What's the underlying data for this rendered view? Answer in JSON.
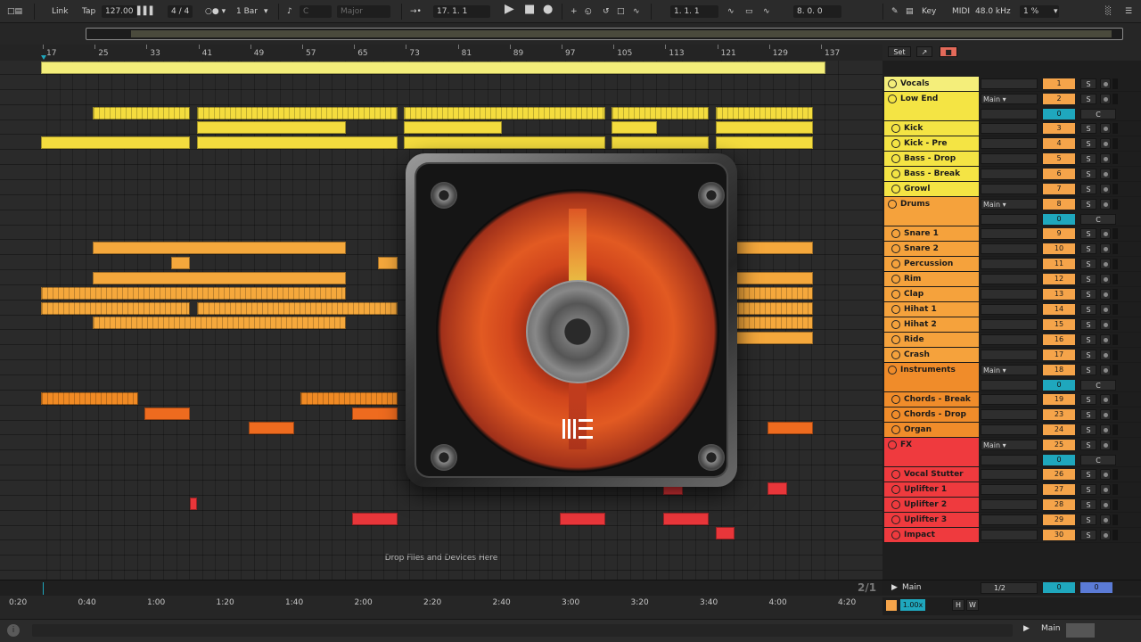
{
  "transport": {
    "link": "Link",
    "tap": "Tap",
    "tempo": "127.00",
    "signature": "4 / 4",
    "quantize": "1 Bar",
    "key_root": "C",
    "scale": "Major",
    "position": "17.  1.  1",
    "loop_start": "1.  1.  1",
    "loop_length": "8.  0.  0",
    "key_label": "Key",
    "midi_label": "MIDI",
    "sample_rate": "48.0 kHz",
    "cpu": "1 %"
  },
  "ruler": [
    "17",
    "25",
    "33",
    "41",
    "49",
    "57",
    "65",
    "73",
    "81",
    "89",
    "97",
    "105",
    "113",
    "121",
    "129",
    "137"
  ],
  "drop_hint": "Drop Files and Devices Here",
  "set_buttons": {
    "set": "Set"
  },
  "colors": {
    "yellow": "#f4dc3e",
    "yellow_light": "#f6f07a",
    "orange": "#f5a83c",
    "orange_dark": "#f08a24",
    "deep_orange": "#ee6b1f",
    "red": "#e8363a"
  },
  "tracks": [
    {
      "name": "Vocals",
      "color": "#f4ee7a",
      "group": false,
      "child": false,
      "number": "1",
      "height": 17
    },
    {
      "name": "Low End",
      "color": "#f4e444",
      "group": true,
      "child": false,
      "number": "2",
      "routing": "Main",
      "pan": "0",
      "c": "C",
      "height": 33
    },
    {
      "name": "Kick",
      "color": "#f4e444",
      "group": false,
      "child": true,
      "number": "3",
      "height": 17
    },
    {
      "name": "Kick - Pre",
      "color": "#f4e444",
      "group": false,
      "child": true,
      "number": "4",
      "height": 17
    },
    {
      "name": "Bass - Drop",
      "color": "#f4e444",
      "group": false,
      "child": true,
      "number": "5",
      "height": 17
    },
    {
      "name": "Bass - Break",
      "color": "#f4e444",
      "group": false,
      "child": true,
      "number": "6",
      "height": 17
    },
    {
      "name": "Growl",
      "color": "#f4e444",
      "group": false,
      "child": true,
      "number": "7",
      "height": 17
    },
    {
      "name": "Drums",
      "color": "#f5a23c",
      "group": true,
      "child": false,
      "number": "8",
      "routing": "Main",
      "pan": "0",
      "c": "C",
      "height": 33
    },
    {
      "name": "Snare 1",
      "color": "#f5a23c",
      "group": false,
      "child": true,
      "number": "9",
      "height": 17
    },
    {
      "name": "Snare 2",
      "color": "#f5a23c",
      "group": false,
      "child": true,
      "number": "10",
      "height": 17
    },
    {
      "name": "Percussion",
      "color": "#f5a23c",
      "group": false,
      "child": true,
      "number": "11",
      "height": 17
    },
    {
      "name": "Rim",
      "color": "#f5a23c",
      "group": false,
      "child": true,
      "number": "12",
      "height": 17
    },
    {
      "name": "Clap",
      "color": "#f5a23c",
      "group": false,
      "child": true,
      "number": "13",
      "height": 17
    },
    {
      "name": "Hihat 1",
      "color": "#f5a23c",
      "group": false,
      "child": true,
      "number": "14",
      "height": 17
    },
    {
      "name": "Hihat 2",
      "color": "#f5a23c",
      "group": false,
      "child": true,
      "number": "15",
      "height": 17
    },
    {
      "name": "Ride",
      "color": "#f5a23c",
      "group": false,
      "child": true,
      "number": "16",
      "height": 17
    },
    {
      "name": "Crash",
      "color": "#f5a23c",
      "group": false,
      "child": true,
      "number": "17",
      "height": 17
    },
    {
      "name": "Instruments",
      "color": "#f08c2a",
      "group": true,
      "child": false,
      "number": "18",
      "routing": "Main",
      "pan": "0",
      "c": "C",
      "height": 33
    },
    {
      "name": "Chords - Break",
      "color": "#f08c2a",
      "group": false,
      "child": true,
      "number": "19",
      "height": 17
    },
    {
      "name": "Chords - Drop",
      "color": "#f08c2a",
      "group": false,
      "child": true,
      "number": "23",
      "height": 17
    },
    {
      "name": "Organ",
      "color": "#f08c2a",
      "group": false,
      "child": true,
      "number": "24",
      "height": 17
    },
    {
      "name": "FX",
      "color": "#ef3a3e",
      "group": true,
      "child": false,
      "number": "25",
      "routing": "Main",
      "pan": "0",
      "c": "C",
      "height": 33
    },
    {
      "name": "Vocal Stutter",
      "color": "#ef3a3e",
      "group": false,
      "child": true,
      "number": "26",
      "height": 17
    },
    {
      "name": "Uplifter 1",
      "color": "#ef3a3e",
      "group": false,
      "child": true,
      "number": "27",
      "height": 17
    },
    {
      "name": "Uplifter 2",
      "color": "#ef3a3e",
      "group": false,
      "child": true,
      "number": "28",
      "height": 17
    },
    {
      "name": "Uplifter 3",
      "color": "#ef3a3e",
      "group": false,
      "child": true,
      "number": "29",
      "height": 17
    },
    {
      "name": "Impact",
      "color": "#ef3a3e",
      "group": false,
      "child": true,
      "number": "30",
      "height": 17
    }
  ],
  "solo_label": "S",
  "clips": [
    {
      "lane": 0,
      "bars": [
        [
          17,
          138
        ]
      ],
      "color": "#f4ee7a",
      "notes": false
    },
    {
      "lane": 3,
      "bars": [
        [
          25,
          40
        ],
        [
          41,
          72
        ],
        [
          73,
          104
        ],
        [
          105,
          120
        ],
        [
          121,
          136
        ]
      ],
      "color": "#f4dc3e",
      "notes": true
    },
    {
      "lane": 4,
      "bars": [
        [
          41,
          64
        ],
        [
          73,
          88
        ],
        [
          105,
          112
        ],
        [
          121,
          136
        ]
      ],
      "color": "#f4dc3e",
      "notes": false
    },
    {
      "lane": 5,
      "bars": [
        [
          17,
          40
        ],
        [
          41,
          72
        ],
        [
          73,
          104
        ],
        [
          105,
          120
        ],
        [
          121,
          136
        ]
      ],
      "color": "#f4dc3e",
      "notes": false
    },
    {
      "lane": 12,
      "bars": [
        [
          25,
          64
        ],
        [
          121,
          136
        ]
      ],
      "color": "#f5a83c",
      "notes": false
    },
    {
      "lane": 13,
      "bars": [
        [
          37,
          40
        ],
        [
          69,
          72
        ]
      ],
      "color": "#f5a83c",
      "notes": false
    },
    {
      "lane": 14,
      "bars": [
        [
          25,
          64
        ],
        [
          121,
          136
        ]
      ],
      "color": "#f5a83c",
      "notes": false
    },
    {
      "lane": 15,
      "bars": [
        [
          17,
          64
        ],
        [
          121,
          136
        ]
      ],
      "color": "#f5a83c",
      "notes": true
    },
    {
      "lane": 16,
      "bars": [
        [
          17,
          40
        ],
        [
          41,
          72
        ],
        [
          121,
          136
        ]
      ],
      "color": "#f5a83c",
      "notes": true
    },
    {
      "lane": 17,
      "bars": [
        [
          25,
          64
        ],
        [
          121,
          136
        ]
      ],
      "color": "#f5a83c",
      "notes": true
    },
    {
      "lane": 18,
      "bars": [
        [
          121,
          136
        ]
      ],
      "color": "#f5a83c",
      "notes": false
    },
    {
      "lane": 22,
      "bars": [
        [
          17,
          32
        ],
        [
          57,
          72
        ]
      ],
      "color": "#f08a24",
      "notes": true
    },
    {
      "lane": 23,
      "bars": [
        [
          33,
          40
        ],
        [
          65,
          72
        ]
      ],
      "color": "#ee6b1f",
      "notes": false
    },
    {
      "lane": 24,
      "bars": [
        [
          49,
          56
        ],
        [
          129,
          136
        ]
      ],
      "color": "#ee6b1f",
      "notes": false
    },
    {
      "lane": 28,
      "bars": [
        [
          113,
          116
        ],
        [
          129,
          132
        ]
      ],
      "color": "#e8363a",
      "notes": false
    },
    {
      "lane": 29,
      "bars": [
        [
          40,
          41
        ]
      ],
      "color": "#e8363a",
      "notes": false
    },
    {
      "lane": 30,
      "bars": [
        [
          65,
          72
        ],
        [
          97,
          104
        ],
        [
          113,
          120
        ]
      ],
      "color": "#e8363a",
      "notes": false
    },
    {
      "lane": 31,
      "bars": [
        [
          121,
          124
        ]
      ],
      "color": "#e8363a",
      "notes": false
    }
  ],
  "time_labels": [
    "0:20",
    "0:40",
    "1:00",
    "1:20",
    "1:40",
    "2:00",
    "2:20",
    "2:40",
    "3:00",
    "3:20",
    "3:40",
    "4:00",
    "4:20"
  ],
  "zoom_label": "2/1",
  "main_track": {
    "name": "Main",
    "routing": "1/2",
    "pan_a": "0",
    "pan_b": "0"
  },
  "status": {
    "zoom": "1.00x",
    "h": "H",
    "w": "W",
    "output": "Main"
  }
}
